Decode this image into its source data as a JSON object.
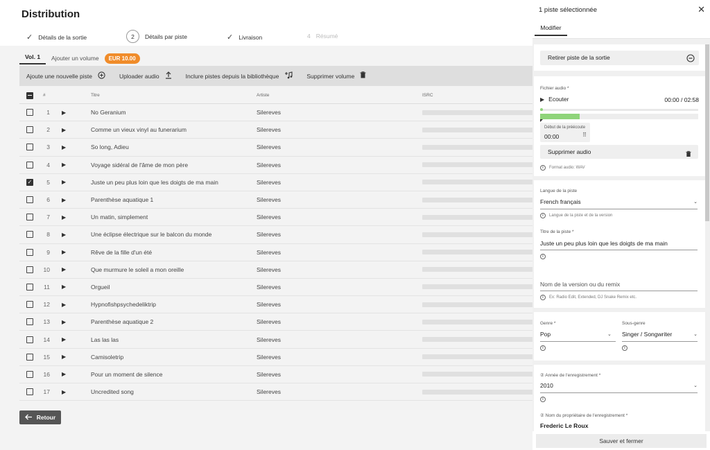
{
  "header": {
    "title": "Distribution",
    "steps": [
      {
        "label": "Détails de la sortie",
        "state": "done"
      },
      {
        "label": "Détails par piste",
        "state": "current",
        "number": "2"
      },
      {
        "label": "Livraison",
        "state": "done"
      },
      {
        "label": "Résumé",
        "state": "disabled",
        "number": "4"
      }
    ]
  },
  "tabs": {
    "vol1": "Vol. 1",
    "add_volume": "Ajouter un volume",
    "price": "EUR 10.00"
  },
  "toolbar": {
    "add_track": "Ajoute une nouvelle piste",
    "upload_audio": "Uploader audio",
    "include_library": "Inclure pistes depuis la bibliothèque",
    "delete_volume": "Supprimer volume"
  },
  "table": {
    "columns": {
      "num": "#",
      "title": "Titre",
      "artist": "Artiste",
      "isrc": "ISRC"
    },
    "rows": [
      {
        "num": "1",
        "title": "No Geranium",
        "artist": "Silereves",
        "checked": false
      },
      {
        "num": "2",
        "title": "Comme un vieux vinyl au funerarium",
        "artist": "Silereves",
        "checked": false
      },
      {
        "num": "3",
        "title": "So long, Adieu",
        "artist": "Silereves",
        "checked": false
      },
      {
        "num": "4",
        "title": "Voyage sidéral de l'âme de mon père",
        "artist": "Silereves",
        "checked": false
      },
      {
        "num": "5",
        "title": "Juste un peu plus loin que les doigts de ma main",
        "artist": "Silereves",
        "checked": true
      },
      {
        "num": "6",
        "title": "Parenthèse aquatique 1",
        "artist": "Silereves",
        "checked": false
      },
      {
        "num": "7",
        "title": "Un matin, simplement",
        "artist": "Silereves",
        "checked": false
      },
      {
        "num": "8",
        "title": "Une éclipse électrique sur le balcon du monde",
        "artist": "Silereves",
        "checked": false
      },
      {
        "num": "9",
        "title": "Rêve de la fille d'un été",
        "artist": "Silereves",
        "checked": false
      },
      {
        "num": "10",
        "title": "Que murmure le soleil a mon oreille",
        "artist": "Silereves",
        "checked": false
      },
      {
        "num": "11",
        "title": "Orgueil",
        "artist": "Silereves",
        "checked": false
      },
      {
        "num": "12",
        "title": "Hypnofishpsychedeliktrip",
        "artist": "Silereves",
        "checked": false
      },
      {
        "num": "13",
        "title": "Parenthèse aquatique 2",
        "artist": "Silereves",
        "checked": false
      },
      {
        "num": "14",
        "title": "Las las las",
        "artist": "Silereves",
        "checked": false
      },
      {
        "num": "15",
        "title": "Camisoletrip",
        "artist": "Silereves",
        "checked": false
      },
      {
        "num": "16",
        "title": "Pour un moment de silence",
        "artist": "Silereves",
        "checked": false
      },
      {
        "num": "17",
        "title": "Uncredited song",
        "artist": "Silereves",
        "checked": false
      }
    ]
  },
  "back_button": "Retour",
  "panel": {
    "title": "1 piste sélectionnée",
    "tab": "Modifier",
    "remove_track": "Retirer piste de la sortie",
    "audio_file_label": "Fichier audio *",
    "listen": "Ecouter",
    "time": "00:00 / 02:58",
    "audio_progress": 0.0,
    "preview_bar_fill": 0.25,
    "preview_start_label": "Début de la préécoute",
    "preview_start_value": "00:00",
    "delete_audio": "Supprimer audio",
    "audio_format": "Format audio: WAV",
    "language_label": "Langue de la piste",
    "language_value": "French français",
    "language_hint": "Langue de la piste et de la version",
    "track_title_label": "Titre de la piste *",
    "track_title_value": "Juste un peu plus loin que les doigts de ma main",
    "version_placeholder": "Nom de la version ou du remix",
    "version_hint": "Ex: Radio Edit, Extended, DJ Snake Remix etc.",
    "genre_label": "Genre *",
    "genre_value": "Pop",
    "subgenre_label": "Sous-genre",
    "subgenre_value": "Singer / Songwriter",
    "year_label": "② Année de l'enregistrement *",
    "year_value": "2010",
    "owner_label": "② Nom du propriétaire de l'enregistrement *",
    "owner_value": "Frederic Le Roux",
    "save_close": "Sauver et fermer"
  },
  "colors": {
    "accent_orange": "#f08c2a",
    "progress_green": "#8fd47a",
    "dark_button": "#555555"
  }
}
